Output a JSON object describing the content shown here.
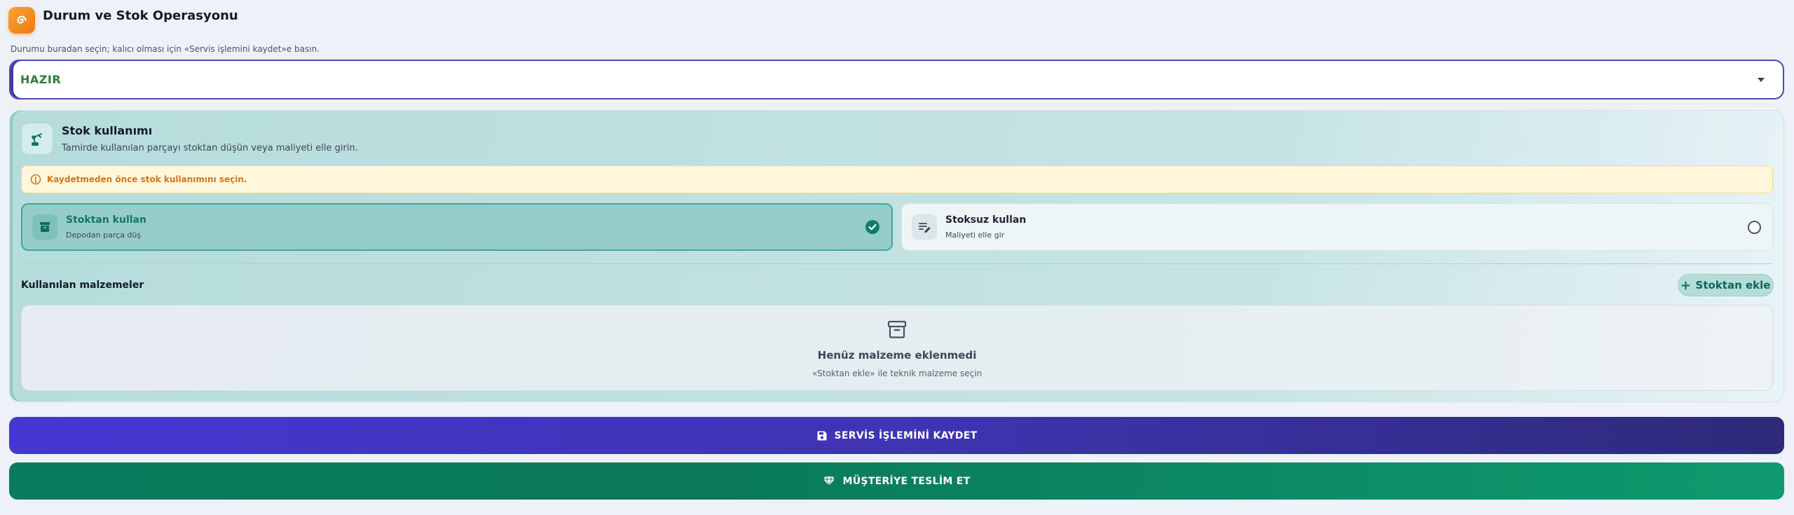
{
  "header": {
    "title": "Durum ve Stok Operasyonu",
    "logo_icon": "spiral-icon",
    "logo_color": "#f08a1c"
  },
  "status": {
    "hint": "Durumu buradan seçin; kalıcı olması için «Servis işlemini kaydet»e basın.",
    "selected": "HAZIR",
    "selected_color": "#2f7d3a"
  },
  "stock": {
    "title": "Stok kullanımı",
    "subtitle": "Tamirde kullanılan parçayı stoktan düşün veya maliyeti elle girin.",
    "warning": "Kaydetmeden önce stok kullanımını seçin.",
    "options": [
      {
        "title": "Stoktan kullan",
        "subtitle": "Depodan parça düş",
        "selected": true,
        "icon": "archive-icon"
      },
      {
        "title": "Stoksuz kullan",
        "subtitle": "Maliyeti elle gir",
        "selected": false,
        "icon": "edit-list-icon"
      }
    ],
    "materials_label": "Kullanılan malzemeler",
    "add_button": "Stoktan ekle",
    "empty_title": "Henüz malzeme eklenmedi",
    "empty_subtitle": "«Stoktan ekle» ile teknik malzeme seçin"
  },
  "actions": {
    "save": "SERVİS İŞLEMİNİ KAYDET",
    "deliver": "MÜŞTERİYE TESLİM ET"
  }
}
